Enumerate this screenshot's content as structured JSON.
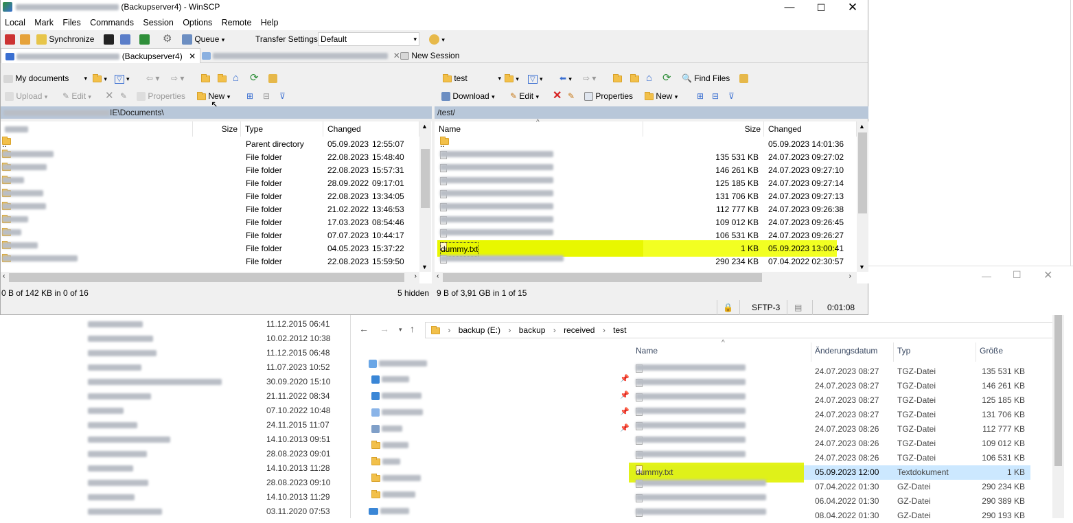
{
  "winscp": {
    "title": "(Backupserver4) - WinSCP",
    "menu": [
      "Local",
      "Mark",
      "Files",
      "Commands",
      "Session",
      "Options",
      "Remote",
      "Help"
    ],
    "toolbar": {
      "synchronize": "Synchronize",
      "queue": "Queue",
      "transfer_settings": "Transfer Settings",
      "transfer_value": "Default"
    },
    "tabs": {
      "active": "(Backupserver4)",
      "new_session": "New Session"
    },
    "left": {
      "location": "My documents",
      "actions": {
        "upload": "Upload",
        "edit": "Edit",
        "properties": "Properties",
        "new": "New"
      },
      "path_suffix": "IE\\Documents\\",
      "columns": {
        "size": "Size",
        "type": "Type",
        "changed": "Changed"
      },
      "rows": [
        {
          "type": "Parent directory",
          "date": "05.09.2023",
          "time": "12:55:07"
        },
        {
          "type": "File folder",
          "date": "22.08.2023",
          "time": "15:48:40"
        },
        {
          "type": "File folder",
          "date": "22.08.2023",
          "time": "15:57:31"
        },
        {
          "type": "File folder",
          "date": "28.09.2022",
          "time": "09:17:01"
        },
        {
          "type": "File folder",
          "date": "22.08.2023",
          "time": "13:34:05"
        },
        {
          "type": "File folder",
          "date": "21.02.2022",
          "time": "13:46:53"
        },
        {
          "type": "File folder",
          "date": "17.03.2023",
          "time": "08:54:46"
        },
        {
          "type": "File folder",
          "date": "07.07.2023",
          "time": "10:44:17"
        },
        {
          "type": "File folder",
          "date": "04.05.2023",
          "time": "15:37:22"
        },
        {
          "type": "File folder",
          "date": "22.08.2023",
          "time": "15:59:50"
        }
      ],
      "status": "0 B of 142 KB in 0 of 16",
      "hidden": "5 hidden"
    },
    "right": {
      "location": "test",
      "find_files": "Find Files",
      "actions": {
        "download": "Download",
        "edit": "Edit",
        "properties": "Properties",
        "new": "New"
      },
      "path": "/test/",
      "columns": {
        "name": "Name",
        "size": "Size",
        "changed": "Changed"
      },
      "parent": {
        "name": "..",
        "changed": "05.09.2023 14:01:36"
      },
      "rows": [
        {
          "size": "135 531 KB",
          "changed": "24.07.2023 09:27:02"
        },
        {
          "size": "146 261 KB",
          "changed": "24.07.2023 09:27:10"
        },
        {
          "size": "125 185 KB",
          "changed": "24.07.2023 09:27:14"
        },
        {
          "size": "131 706 KB",
          "changed": "24.07.2023 09:27:13"
        },
        {
          "size": "112 777 KB",
          "changed": "24.07.2023 09:26:38"
        },
        {
          "size": "109 012 KB",
          "changed": "24.07.2023 09:26:45"
        },
        {
          "size": "106 531 KB",
          "changed": "24.07.2023 09:26:27"
        }
      ],
      "dummy": {
        "name": "dummy.txt",
        "size": "1 KB",
        "changed": "05.09.2023 13:00:41"
      },
      "last": {
        "size": "290 234 KB",
        "changed": "07.04.2022 02:30:57"
      },
      "status": "9 B of 3,91 GB in 1 of 15"
    },
    "session": {
      "protocol": "SFTP-3",
      "time": "0:01:08"
    }
  },
  "explorer": {
    "breadcrumb": [
      "backup (E:)",
      "backup",
      "received",
      "test"
    ],
    "columns": {
      "name": "Name",
      "date": "Änderungsdatum",
      "type": "Typ",
      "size": "Größe"
    },
    "rows": [
      {
        "date": "24.07.2023 08:27",
        "type": "TGZ-Datei",
        "size": "135 531 KB"
      },
      {
        "date": "24.07.2023 08:27",
        "type": "TGZ-Datei",
        "size": "146 261 KB"
      },
      {
        "date": "24.07.2023 08:27",
        "type": "TGZ-Datei",
        "size": "125 185 KB"
      },
      {
        "date": "24.07.2023 08:27",
        "type": "TGZ-Datei",
        "size": "131 706 KB"
      },
      {
        "date": "24.07.2023 08:26",
        "type": "TGZ-Datei",
        "size": "112 777 KB"
      },
      {
        "date": "24.07.2023 08:26",
        "type": "TGZ-Datei",
        "size": "109 012 KB"
      },
      {
        "date": "24.07.2023 08:26",
        "type": "TGZ-Datei",
        "size": "106 531 KB"
      }
    ],
    "dummy": {
      "name": "dummy.txt",
      "date": "05.09.2023 12:00",
      "type": "Textdokument",
      "size": "1 KB"
    },
    "tail": [
      {
        "date": "07.04.2022 01:30",
        "type": "GZ-Datei",
        "size": "290 234 KB"
      },
      {
        "date": "06.04.2022 01:30",
        "type": "GZ-Datei",
        "size": "290 389 KB"
      },
      {
        "date": "08.04.2022 01:30",
        "type": "GZ-Datei",
        "size": "290 193 KB"
      }
    ],
    "left_dates": [
      "11.12.2015 06:41",
      "10.02.2012 10:38",
      "11.12.2015 06:48",
      "11.07.2023 10:52",
      "30.09.2020 15:10",
      "21.11.2022 08:34",
      "07.10.2022 10:48",
      "24.11.2015 11:07",
      "14.10.2013 09:51",
      "28.08.2023 09:01",
      "14.10.2013 11:28",
      "28.08.2023 09:10",
      "14.10.2013 11:29",
      "03.11.2020 07:53"
    ]
  }
}
